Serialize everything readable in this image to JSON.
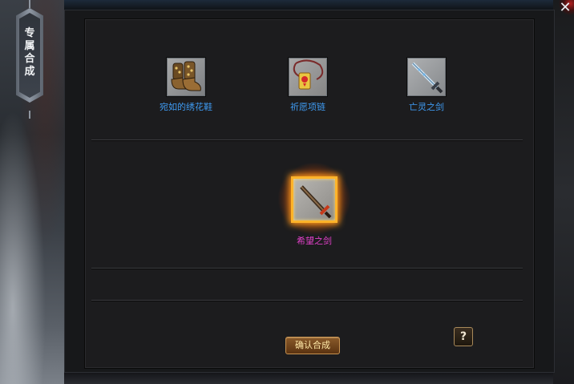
{
  "side_tab": {
    "label_chars": [
      "专",
      "属",
      "合",
      "成"
    ]
  },
  "close": {
    "glyph": "✕"
  },
  "materials": [
    {
      "name": "宛如的绣花鞋",
      "icon": "embroidered-boots-icon"
    },
    {
      "name": "祈愿项链",
      "icon": "prayer-necklace-icon"
    },
    {
      "name": "亡灵之剑",
      "icon": "undead-sword-icon"
    }
  ],
  "result": {
    "name": "希望之剑",
    "icon": "hope-sword-icon"
  },
  "buttons": {
    "confirm": "确认合成",
    "help": "?"
  },
  "colors": {
    "material_name": "#3f9bf2",
    "result_name": "#e040c8",
    "result_frame": "#ffb42a",
    "confirm_text": "#ffe9a8"
  }
}
